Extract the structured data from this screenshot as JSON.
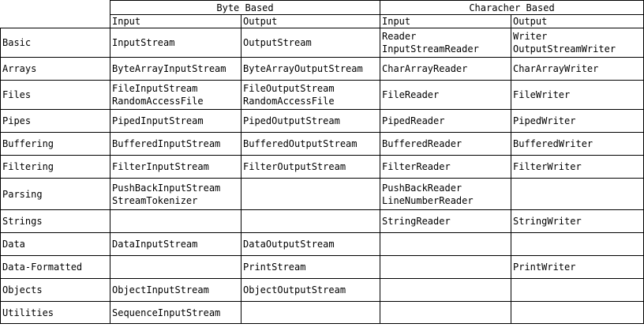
{
  "headers": {
    "byte_group": "Byte Based",
    "char_group": "Characher Based",
    "byte_input": "Input",
    "byte_output": "Output",
    "char_input": "Input",
    "char_output": "Output"
  },
  "rows": [
    {
      "label": "Basic",
      "byte_input": [
        "InputStream"
      ],
      "byte_output": [
        "OutputStream"
      ],
      "char_input": [
        "Reader",
        "InputStreamReader"
      ],
      "char_output": [
        "Writer",
        "OutputStreamWriter"
      ]
    },
    {
      "label": "Arrays",
      "byte_input": [
        "ByteArrayInputStream"
      ],
      "byte_output": [
        "ByteArrayOutputStream"
      ],
      "char_input": [
        "CharArrayReader"
      ],
      "char_output": [
        "CharArrayWriter"
      ]
    },
    {
      "label": "Files",
      "byte_input": [
        "FileInputStream",
        "RandomAccessFile"
      ],
      "byte_output": [
        "FileOutputStream",
        "RandomAccessFile"
      ],
      "char_input": [
        "FileReader"
      ],
      "char_output": [
        "FileWriter"
      ]
    },
    {
      "label": "Pipes",
      "byte_input": [
        "PipedInputStream"
      ],
      "byte_output": [
        "PipedOutputStream"
      ],
      "char_input": [
        "PipedReader"
      ],
      "char_output": [
        "PipedWriter"
      ]
    },
    {
      "label": "Buffering",
      "byte_input": [
        "BufferedInputStream"
      ],
      "byte_output": [
        "BufferedOutputStream"
      ],
      "char_input": [
        "BufferedReader"
      ],
      "char_output": [
        "BufferedWriter"
      ]
    },
    {
      "label": "Filtering",
      "byte_input": [
        "FilterInputStream"
      ],
      "byte_output": [
        "FilterOutputStream"
      ],
      "char_input": [
        "FilterReader"
      ],
      "char_output": [
        "FilterWriter"
      ]
    },
    {
      "label": "Parsing",
      "byte_input": [
        "PushBackInputStream",
        "StreamTokenizer"
      ],
      "byte_output": [],
      "char_input": [
        "PushBackReader",
        "LineNumberReader"
      ],
      "char_output": []
    },
    {
      "label": "Strings",
      "byte_input": [],
      "byte_output": [],
      "char_input": [
        "StringReader"
      ],
      "char_output": [
        "StringWriter"
      ]
    },
    {
      "label": "Data",
      "byte_input": [
        "DataInputStream"
      ],
      "byte_output": [
        "DataOutputStream"
      ],
      "char_input": [],
      "char_output": []
    },
    {
      "label": "Data-Formatted",
      "byte_input": [],
      "byte_output": [
        "PrintStream"
      ],
      "char_input": [],
      "char_output": [
        "PrintWriter"
      ]
    },
    {
      "label": "Objects",
      "byte_input": [
        "ObjectInputStream"
      ],
      "byte_output": [
        "ObjectOutputStream"
      ],
      "char_input": [],
      "char_output": []
    },
    {
      "label": "Utilities",
      "byte_input": [
        "SequenceInputStream"
      ],
      "byte_output": [],
      "char_input": [],
      "char_output": []
    }
  ]
}
